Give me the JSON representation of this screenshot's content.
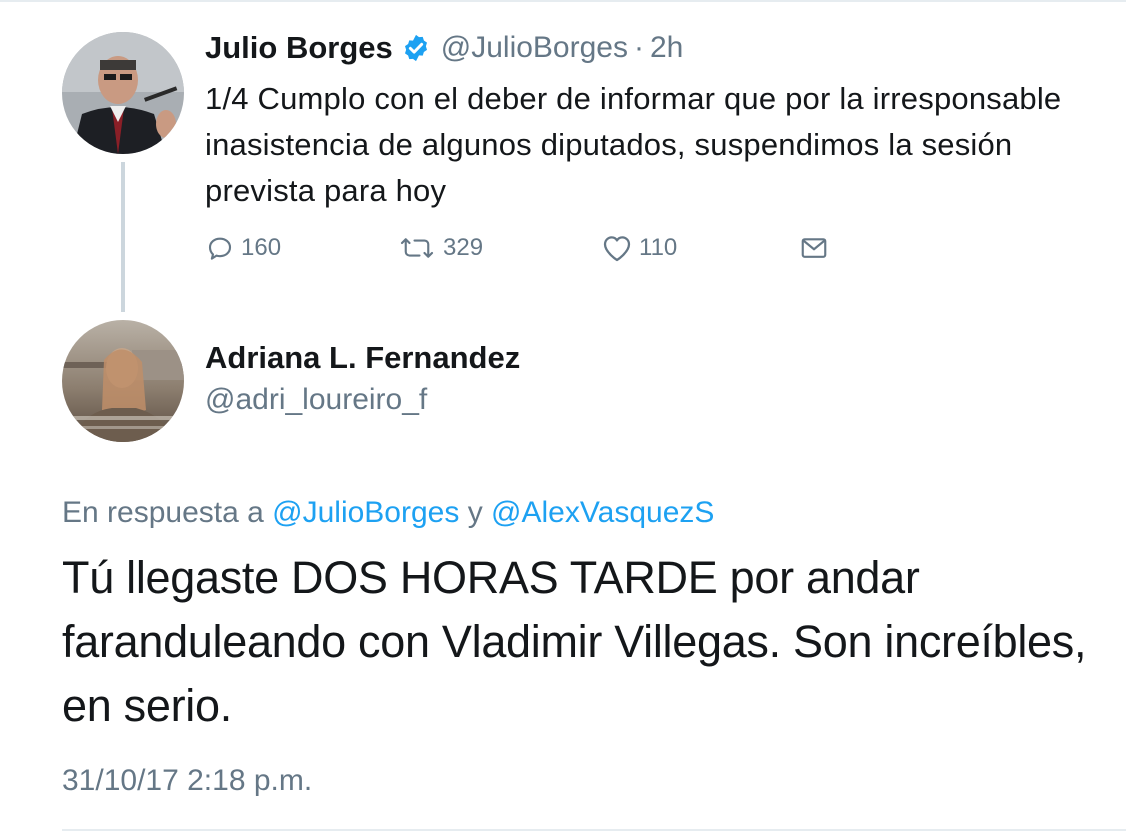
{
  "parent_tweet": {
    "author_name": "Julio Borges",
    "verified_icon": "verified-badge-icon",
    "handle": "@JulioBorges",
    "separator": "·",
    "time_ago": "2h",
    "text": "1/4 Cumplo con el deber de informar que por la irresponsable inasistencia de algunos diputados, suspendimos la sesión prevista para hoy",
    "actions": {
      "reply_count": "160",
      "retweet_count": "329",
      "like_count": "110"
    }
  },
  "reply_tweet": {
    "author_name": "Adriana L. Fernandez",
    "handle": "@adri_loureiro_f",
    "in_reply_prefix": "En respuesta a",
    "mention_1": "@JulioBorges",
    "conjunction": "y",
    "mention_2": "@AlexVasquezS",
    "text": "Tú llegaste DOS HORAS TARDE por andar faranduleando con Vladimir Villegas. Son increíbles, en serio.",
    "timestamp": "31/10/17 2:18 p.m."
  },
  "colors": {
    "text_primary": "#14171a",
    "text_secondary": "#657786",
    "link": "#1da1f2",
    "divider": "#e6ecf0"
  }
}
